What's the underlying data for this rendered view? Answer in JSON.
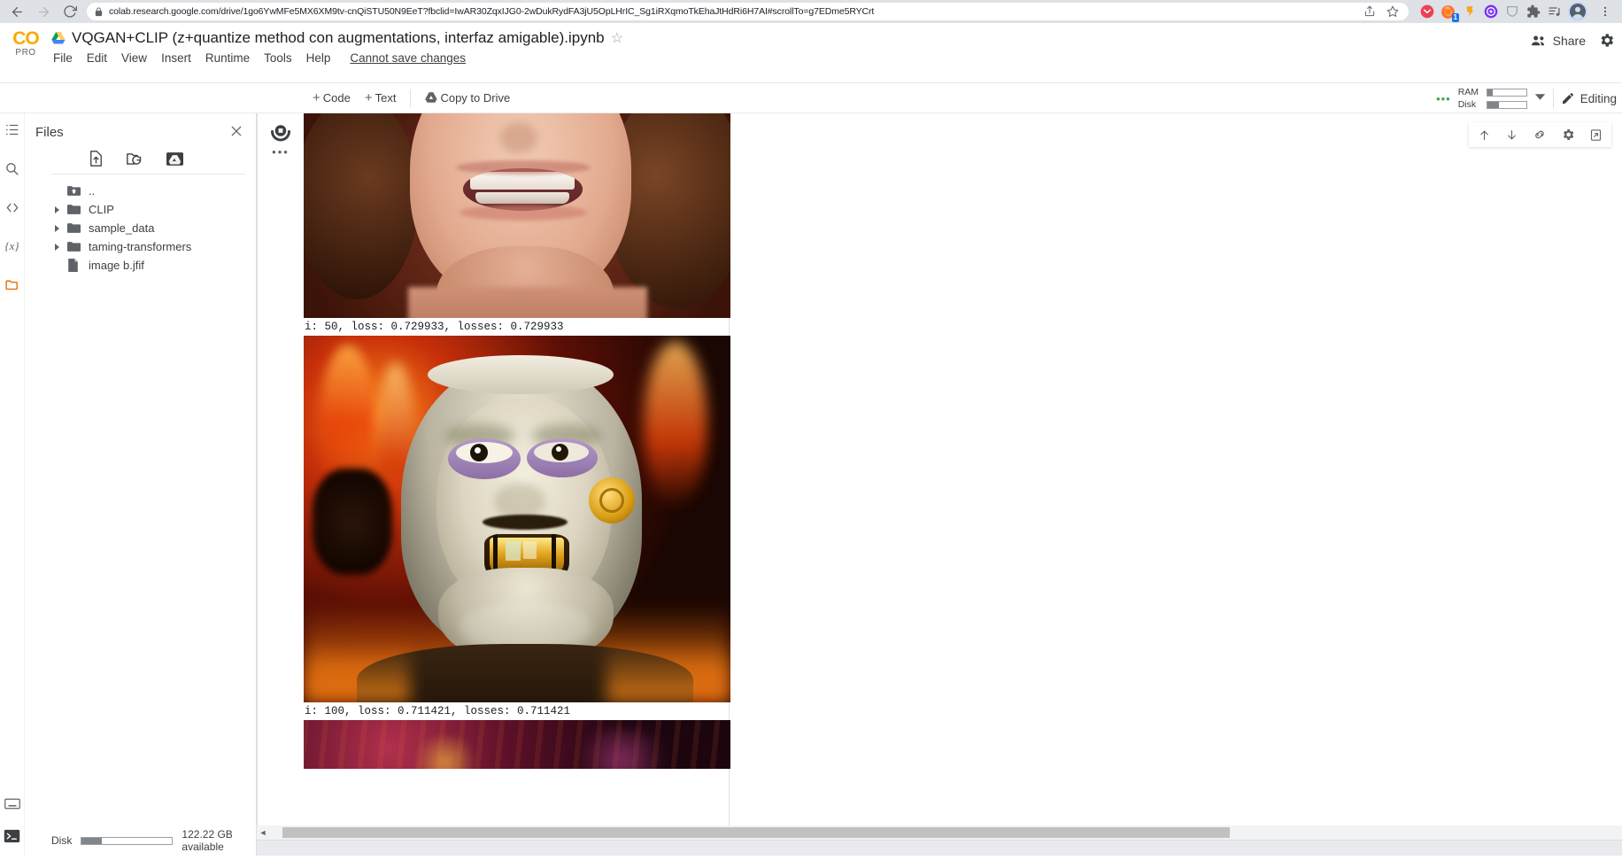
{
  "browser": {
    "back_icon": "back-arrow-icon",
    "forward_icon": "forward-arrow-icon",
    "reload_icon": "reload-icon",
    "lock_icon": "lock-icon",
    "url": "colab.research.google.com/drive/1go6YwMFe5MX6XM9tv-cnQiSTU50N9EeT?fbclid=IwAR30ZqxIJG0-2wDukRydFA3jU5OpLHrIC_Sg1iRXqmoTkEhaJtHdRi6H7AI#scrollTo=g7EDme5RYCrt",
    "share_page_icon": "share-page-icon",
    "bookmark_icon": "star-icon",
    "extensions": [
      {
        "name": "pocket-extension-icon",
        "color": "#EF3F56",
        "badge": ""
      },
      {
        "name": "firefox-extension-icon",
        "color": "#FF7139",
        "badge": "1"
      },
      {
        "name": "honey-extension-icon",
        "color": "#F5A623",
        "badge": ""
      },
      {
        "name": "grammarly-extension-icon",
        "color": "#7B2FF7",
        "badge": ""
      },
      {
        "name": "shield-extension-icon",
        "color": "#9aa0a6",
        "badge": ""
      },
      {
        "name": "puzzle-extensions-icon",
        "color": "#5f6368",
        "badge": ""
      },
      {
        "name": "playlist-extension-icon",
        "color": "#5f6368",
        "badge": ""
      }
    ],
    "profile_avatar": "profile-avatar",
    "menu_icon": "browser-menu-icon"
  },
  "colab": {
    "logo_text": "CO",
    "logo_sub": "PRO",
    "drive_icon": "google-drive-icon",
    "title": "VQGAN+CLIP (z+quantize method con augmentations, interfaz amigable).ipynb",
    "star_glyph": "☆",
    "menus": [
      "File",
      "Edit",
      "View",
      "Insert",
      "Runtime",
      "Tools",
      "Help"
    ],
    "save_status": "Cannot save changes",
    "share_label": "Share",
    "share_icon": "people-icon",
    "settings_icon": "gear-icon"
  },
  "toolbar": {
    "add_code_label": "Code",
    "add_text_label": "Text",
    "plus_glyph": "+",
    "copy_to_drive_label": "Copy to Drive",
    "copy_to_drive_icon": "google-drive-icon",
    "more_dots": "•••",
    "ram_label": "RAM",
    "ram_fill_pct": 14,
    "disk_label": "Disk",
    "disk_fill_pct": 30,
    "resource_caret_icon": "chevron-down-icon",
    "editing_label": "Editing",
    "editing_icon": "pencil-icon"
  },
  "rail": {
    "items": [
      {
        "name": "table-of-contents-icon",
        "glyph": "toc",
        "active": false
      },
      {
        "name": "search-icon",
        "glyph": "search",
        "active": false
      },
      {
        "name": "code-snippets-icon",
        "glyph": "<>",
        "active": false
      },
      {
        "name": "variables-icon",
        "glyph": "{x}",
        "active": false
      },
      {
        "name": "files-icon",
        "glyph": "folder",
        "active": true
      }
    ],
    "bottom": [
      {
        "name": "keyboard-icon",
        "glyph": "keyboard"
      },
      {
        "name": "terminal-icon",
        "glyph": "terminal"
      }
    ]
  },
  "files": {
    "panel_title": "Files",
    "close_icon": "close-icon",
    "actions": [
      {
        "name": "upload-file-icon"
      },
      {
        "name": "refresh-folder-icon"
      },
      {
        "name": "mount-drive-icon"
      }
    ],
    "tree": [
      {
        "label": "..",
        "type": "parent",
        "expandable": false
      },
      {
        "label": "CLIP",
        "type": "folder",
        "expandable": true
      },
      {
        "label": "sample_data",
        "type": "folder",
        "expandable": true
      },
      {
        "label": "taming-transformers",
        "type": "folder",
        "expandable": true
      },
      {
        "label": "image b.jfif",
        "type": "file",
        "expandable": false
      }
    ],
    "disk_label": "Disk",
    "disk_fill_pct": 22,
    "disk_available": "122.22 GB available"
  },
  "cell": {
    "run_state_icon": "stop-running-icon",
    "gutter_more_icon": "more-vert-icon",
    "toolbar_icons": [
      {
        "name": "move-cell-up-icon"
      },
      {
        "name": "move-cell-down-icon"
      },
      {
        "name": "link-to-cell-icon"
      },
      {
        "name": "cell-settings-icon"
      },
      {
        "name": "open-in-new-tab-icon"
      }
    ],
    "outputs": [
      {
        "image_alt": "generated-portrait-smiling-woman",
        "text": "i: 50, loss: 0.729933, losses: 0.729933"
      },
      {
        "image_alt": "generated-fiery-face-artwork",
        "text": "i: 100, loss: 0.711421, losses: 0.711421"
      },
      {
        "image_alt": "generated-dark-purple-artwork",
        "text": ""
      }
    ]
  },
  "scroll": {
    "h_left_arrow": "◄",
    "h_thumb_left_pct": 1,
    "h_thumb_width_pct": 70
  },
  "colors": {
    "colab_orange": "#F9AB00",
    "active_orange": "#E8710A",
    "text_primary": "#202124",
    "text_secondary": "#5f6368",
    "chrome_bg": "#dee1e6"
  }
}
